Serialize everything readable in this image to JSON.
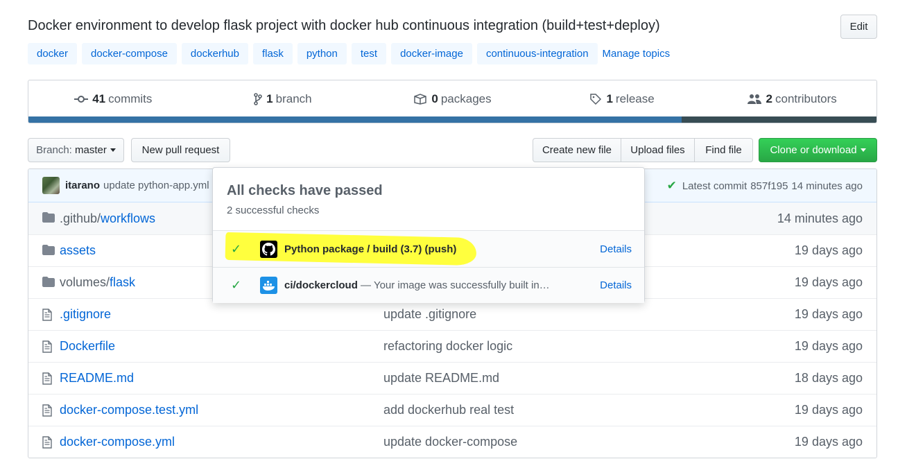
{
  "repo": {
    "description": "Docker environment to develop flask project with docker hub continuous integration (build+test+deploy)",
    "edit_label": "Edit",
    "topics": [
      "docker",
      "docker-compose",
      "dockerhub",
      "flask",
      "python",
      "test",
      "docker-image",
      "continuous-integration"
    ],
    "manage_topics": "Manage topics"
  },
  "summary": {
    "commits": {
      "count": "41",
      "label": "commits"
    },
    "branches": {
      "count": "1",
      "label": "branch"
    },
    "packages": {
      "count": "0",
      "label": "packages"
    },
    "releases": {
      "count": "1",
      "label": "release"
    },
    "contributors": {
      "count": "2",
      "label": "contributors"
    },
    "languages": [
      {
        "color": "#3572a5",
        "fraction": 0.77
      },
      {
        "color": "#384d54",
        "fraction": 0.23
      }
    ]
  },
  "toolbar": {
    "branch_prefix": "Branch:",
    "branch_name": "master",
    "new_pull_request": "New pull request",
    "create_new_file": "Create new file",
    "upload_files": "Upload files",
    "find_file": "Find file",
    "clone_or_download": "Clone or download"
  },
  "commit": {
    "user": "itarano",
    "message": "update python-app.yml",
    "latest_label": "Latest commit",
    "sha": "857f195",
    "time": "14 minutes ago"
  },
  "files": [
    {
      "type": "folder",
      "prefix": ".github/",
      "name": "workflows",
      "message": "",
      "age": "14 minutes ago"
    },
    {
      "type": "folder",
      "prefix": "",
      "name": "assets",
      "message": "",
      "age": "19 days ago"
    },
    {
      "type": "folder",
      "prefix": "volumes/",
      "name": "flask",
      "message": "",
      "age": "19 days ago"
    },
    {
      "type": "file",
      "prefix": "",
      "name": ".gitignore",
      "message": "update .gitignore",
      "age": "19 days ago"
    },
    {
      "type": "file",
      "prefix": "",
      "name": "Dockerfile",
      "message": "refactoring docker logic",
      "age": "19 days ago"
    },
    {
      "type": "file",
      "prefix": "",
      "name": "README.md",
      "message": "update README.md",
      "age": "18 days ago"
    },
    {
      "type": "file",
      "prefix": "",
      "name": "docker-compose.test.yml",
      "message": "add dockerhub real test",
      "age": "19 days ago"
    },
    {
      "type": "file",
      "prefix": "",
      "name": "docker-compose.yml",
      "message": "update docker-compose",
      "age": "19 days ago"
    }
  ],
  "checks": {
    "title": "All checks have passed",
    "subtitle": "2 successful checks",
    "items": [
      {
        "name": "Python package / build (3.7) (push)",
        "description": "",
        "details": "Details",
        "icon": "github-icon"
      },
      {
        "name": "ci/dockercloud",
        "description": " — Your image was successfully built in…",
        "details": "Details",
        "icon": "docker-icon"
      }
    ]
  }
}
